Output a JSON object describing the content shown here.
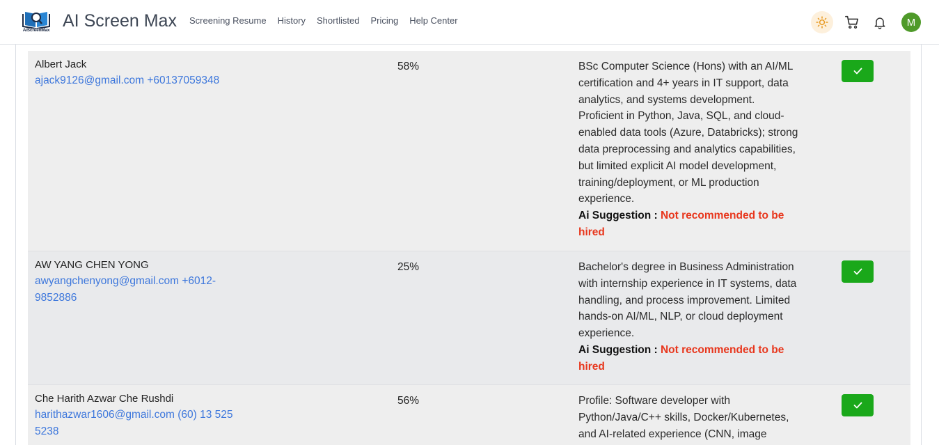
{
  "app": {
    "logo_caption": "AiScreenMax",
    "brand": "AI Screen Max",
    "nav": [
      "Screening Resume",
      "History",
      "Shortlisted",
      "Pricing",
      "Help Center"
    ],
    "avatar_initial": "M",
    "accent_color": "#1aa81a",
    "suggestion_color": "#e8361c",
    "link_color": "#3d77dc"
  },
  "candidates": [
    {
      "name": "Albert Jack",
      "contact": "ajack9126@gmail.com +60137059348",
      "score": "58%",
      "summary": "BSc Computer Science (Hons) with an AI/ML certification and 4+ years in IT support, data analytics, and systems development. Proficient in Python, Java, SQL, and cloud-enabled data tools (Azure, Databricks); strong data preprocessing and analytics capabilities, but limited explicit AI model development, training/deployment, or ML production experience.",
      "suggestion_label": "Ai Suggestion :",
      "suggestion": "Not recommended to be hired"
    },
    {
      "name": "AW YANG CHEN YONG",
      "contact": "awyangchenyong@gmail.com +6012-9852886",
      "score": "25%",
      "summary": "Bachelor's degree in Business Administration with internship experience in IT systems, data handling, and process improvement. Limited hands-on AI/ML, NLP, or cloud deployment experience.",
      "suggestion_label": "Ai Suggestion :",
      "suggestion": "Not recommended to be hired"
    },
    {
      "name": "Che Harith Azwar Che Rushdi",
      "contact": "harithazwar1606@gmail.com (60) 13 525 5238",
      "score": "56%",
      "summary": "Profile: Software developer with Python/Java/C++ skills, Docker/Kubernetes, and AI-related experience (CNN, image"
    }
  ]
}
